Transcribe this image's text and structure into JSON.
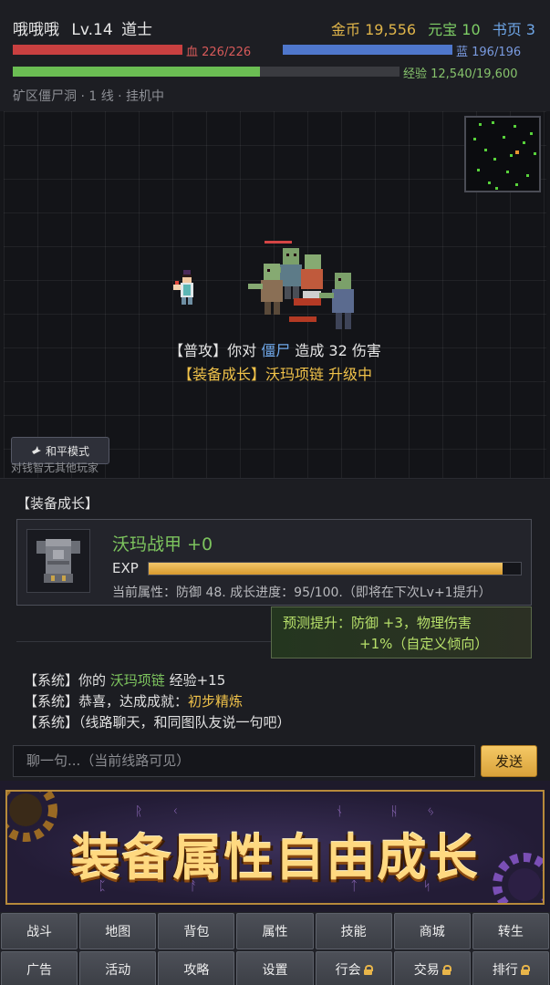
{
  "hud": {
    "player_name": "哦哦哦",
    "level": "Lv.14",
    "class": "道士",
    "gold": "金币 19,556",
    "yuanbao": "元宝 10",
    "book": "书页 3",
    "hp_text": "血 226/226",
    "mp_text": "蓝 196/196",
    "xp_text": "经验 12,540/19,600",
    "hp_fraction": 1.0,
    "mp_fraction": 1.0,
    "xp_fraction": 0.64,
    "location": "矿区僵尸洞 · 1 线 · 挂机中"
  },
  "battle": {
    "line1_prefix": "【普攻】你对",
    "line1_mob": "僵尸",
    "line1_suffix": "造成 32 伤害",
    "line2": "【装备成长】沃玛项链 升级中",
    "peace_label": "和平模式",
    "peace_sub": "对钱智无其他玩家"
  },
  "panel": {
    "title": "【装备成长】",
    "item_name": "沃玛战甲 +0",
    "exp_label": "EXP",
    "exp_fraction": 0.95,
    "item_desc": "当前属性：防御 48. 成长进度：95/100.（即将在下次Lv+1提升）",
    "predict_label": "预测提升：",
    "predict_value1": "防御 +3，物理伤害",
    "predict_value2": "+1%（自定义倾向）",
    "log": [
      {
        "prefix": "【系统】你的",
        "hl": "沃玛项链",
        "suffix": "经验+15"
      },
      {
        "prefix": "【系统】恭喜，达成成就：",
        "hl": "初步精炼",
        "suffix": ""
      },
      {
        "prefix": "【系统】（线路聊天，和同图队友说一句吧）",
        "hl": "",
        "suffix": ""
      }
    ],
    "chat_placeholder": "聊一句...（当前线路可见）",
    "send_label": "发送"
  },
  "banner": {
    "text": "装备属性自由成长"
  },
  "nav": {
    "row1": [
      "战斗",
      "地图",
      "背包",
      "属性",
      "技能",
      "商城",
      "转生"
    ],
    "row2": [
      "广告",
      "活动",
      "攻略",
      "设置",
      "行会",
      "交易",
      "排行"
    ],
    "locked": [
      "行会",
      "交易",
      "排行"
    ]
  },
  "colors": {
    "hp": "#c94040",
    "mp": "#4f77cc",
    "xp": "#6bbd53",
    "gold": "#e0b54a",
    "accent_green": "#7dc45e",
    "accent_yellow": "#f0c24a"
  }
}
